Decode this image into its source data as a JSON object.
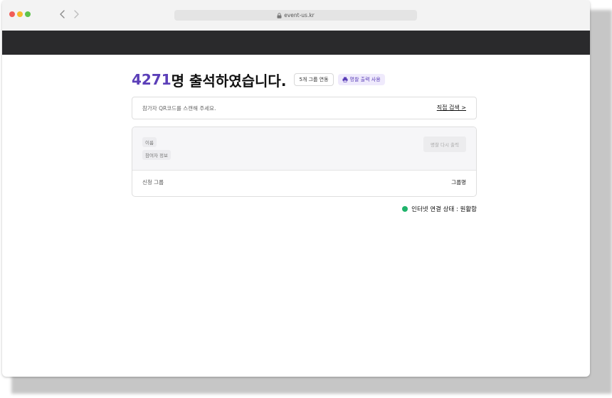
{
  "browser": {
    "url": "event-us.kr"
  },
  "attendance": {
    "count": "4271",
    "heading_suffix": "명 출석하였습니다.",
    "group_badge": "5개 그룹 연동",
    "print_badge": "명찰 출력 사용"
  },
  "scan": {
    "label": "참가자 QR코드를 스캔해 주세요.",
    "direct_search": "직접 검색 >"
  },
  "info_card": {
    "name_tag": "이름",
    "info_tag": "참여자 정보",
    "reprint_button": "명찰 다시 출력",
    "group_label": "신청 그룹",
    "group_value": "그룹명"
  },
  "status": {
    "text": "인터넷 연결 상태 : 원활함",
    "color": "#1fb36b"
  },
  "colors": {
    "accent": "#5b3fb8",
    "dark_bar": "#2a2a2c"
  }
}
